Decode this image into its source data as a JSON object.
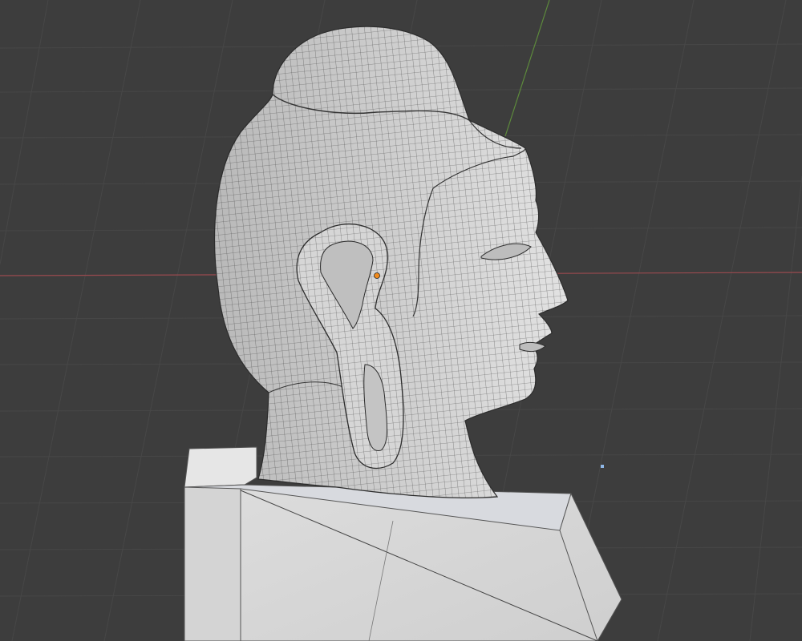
{
  "viewport": {
    "background": "#3d3d3d",
    "grid_color": "#474747",
    "x_axis_color": "#9a4a4f",
    "y_axis_color": "#5d8a3c",
    "mesh_fill": "#c9c9c9",
    "mesh_wire": "#2a2a2a",
    "origin_color": "#f08a1c",
    "light_color": "#8fb7e6"
  },
  "scene": {
    "object": "head-bust-mesh",
    "mode": "edit-wireframe"
  }
}
